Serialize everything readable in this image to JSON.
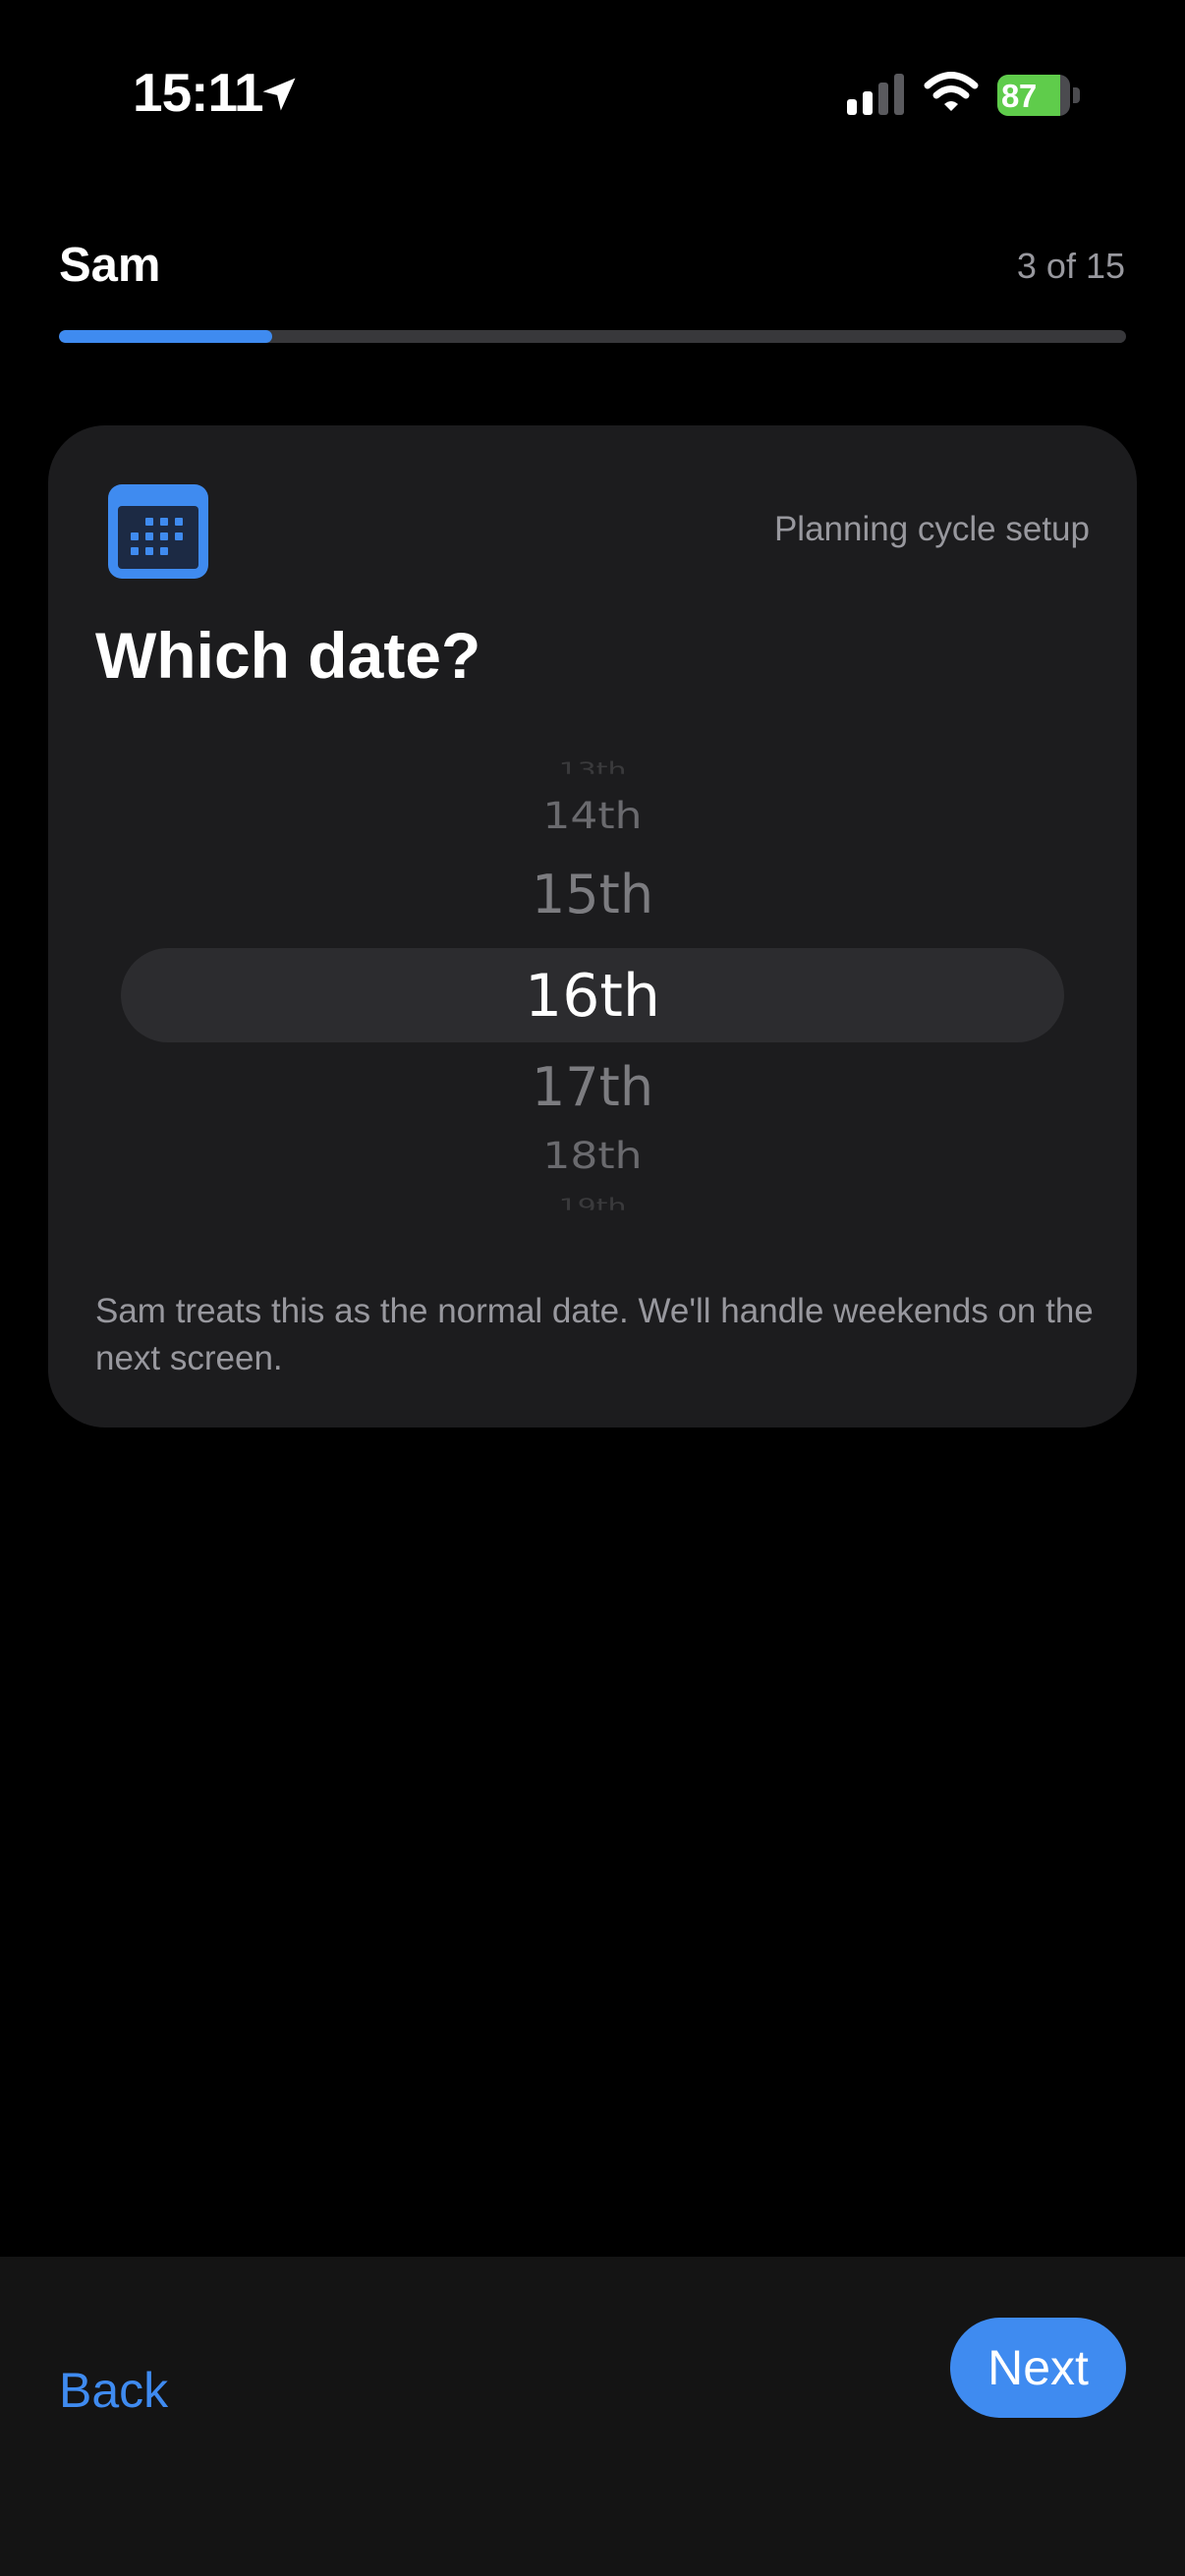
{
  "status_bar": {
    "time": "15:11",
    "battery_percent": "87",
    "battery_level": 0.87,
    "icons": [
      "location-arrow-icon",
      "cellular-signal-icon",
      "wifi-icon",
      "battery-charging-icon"
    ]
  },
  "header": {
    "title": "Sam",
    "step_counter": "3 of 15",
    "progress_fraction": 0.2
  },
  "card": {
    "icon": "calendar-icon",
    "section_label": "Planning cycle setup",
    "question": "Which date?",
    "picker": {
      "items": [
        "13th",
        "14th",
        "15th",
        "16th",
        "17th",
        "18th",
        "19th"
      ],
      "selected": "16th"
    },
    "helper_text": "Sam treats this as the normal date. We'll handle weekends on the next screen."
  },
  "footer": {
    "back_label": "Back",
    "next_label": "Next"
  },
  "colors": {
    "accent": "#3f8bf0",
    "battery_fill": "#5fcc4b",
    "card_bg": "#1c1c1e",
    "secondary_text": "#98989e"
  }
}
